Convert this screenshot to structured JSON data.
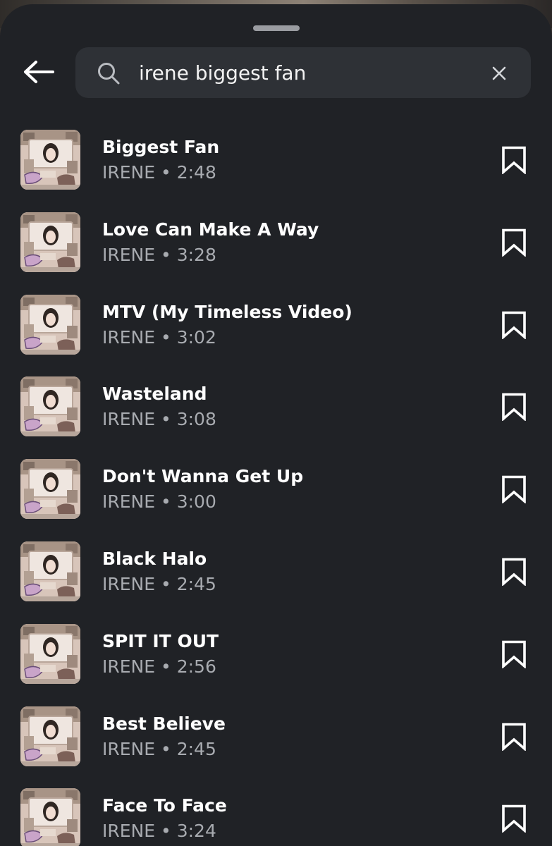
{
  "search": {
    "query": "irene biggest fan",
    "icon": "search-icon",
    "clear_icon": "close-icon",
    "back_icon": "arrow-left-icon"
  },
  "colors": {
    "sheet_background": "#202226",
    "search_background": "#2e3136",
    "title_text": "#ffffff",
    "meta_text": "#a8abb0"
  },
  "results": [
    {
      "title": "Biggest Fan",
      "artist": "IRENE",
      "separator": "•",
      "duration": "2:48",
      "save_icon": "bookmark-icon"
    },
    {
      "title": "Love Can Make A Way",
      "artist": "IRENE",
      "separator": "•",
      "duration": "3:28",
      "save_icon": "bookmark-icon"
    },
    {
      "title": "MTV (My Timeless Video)",
      "artist": "IRENE",
      "separator": "•",
      "duration": "3:02",
      "save_icon": "bookmark-icon"
    },
    {
      "title": "Wasteland",
      "artist": "IRENE",
      "separator": "•",
      "duration": "3:08",
      "save_icon": "bookmark-icon"
    },
    {
      "title": "Don't Wanna Get Up",
      "artist": "IRENE",
      "separator": "•",
      "duration": "3:00",
      "save_icon": "bookmark-icon"
    },
    {
      "title": "Black Halo",
      "artist": "IRENE",
      "separator": "•",
      "duration": "2:45",
      "save_icon": "bookmark-icon"
    },
    {
      "title": "SPIT IT OUT",
      "artist": "IRENE",
      "separator": "•",
      "duration": "2:56",
      "save_icon": "bookmark-icon"
    },
    {
      "title": "Best Believe",
      "artist": "IRENE",
      "separator": "•",
      "duration": "2:45",
      "save_icon": "bookmark-icon"
    },
    {
      "title": "Face To Face",
      "artist": "IRENE",
      "separator": "•",
      "duration": "3:24",
      "save_icon": "bookmark-icon"
    }
  ]
}
